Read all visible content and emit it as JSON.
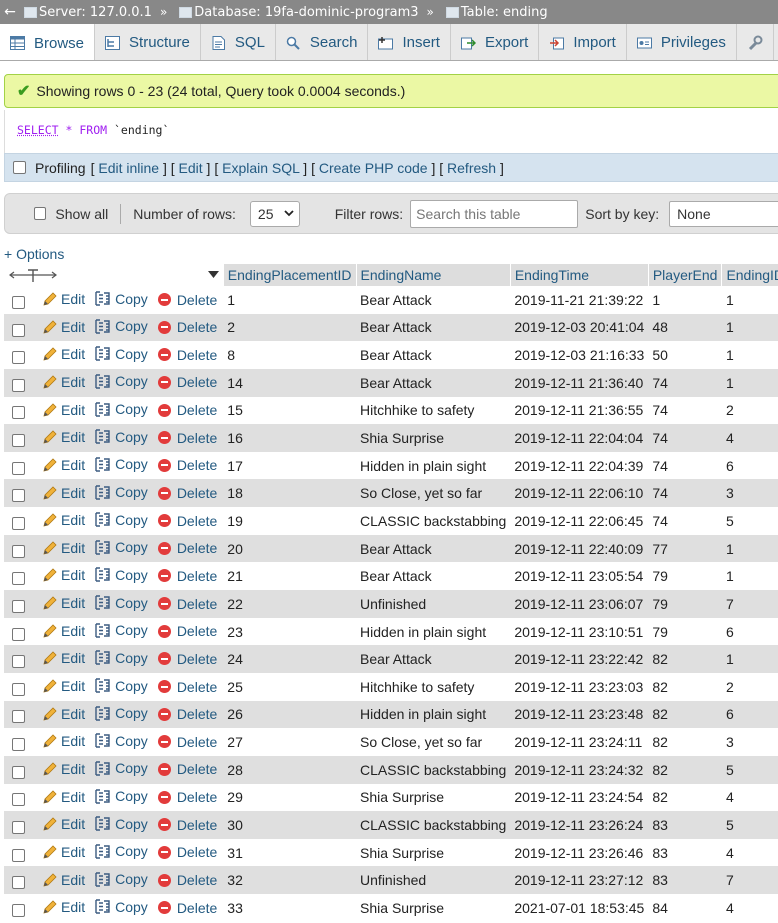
{
  "breadcrumb": {
    "back": "←",
    "server": "Server: 127.0.0.1",
    "database": "Database: 19fa-dominic-program3",
    "table": "Table: ending",
    "separator": "»"
  },
  "tabs": [
    {
      "label": "Browse",
      "icon": "browse-icon",
      "active": true
    },
    {
      "label": "Structure",
      "icon": "structure-icon",
      "active": false
    },
    {
      "label": "SQL",
      "icon": "sql-icon",
      "active": false
    },
    {
      "label": "Search",
      "icon": "search-icon",
      "active": false
    },
    {
      "label": "Insert",
      "icon": "insert-icon",
      "active": false
    },
    {
      "label": "Export",
      "icon": "export-icon",
      "active": false
    },
    {
      "label": "Import",
      "icon": "import-icon",
      "active": false
    },
    {
      "label": "Privileges",
      "icon": "privileges-icon",
      "active": false
    }
  ],
  "message": "Showing rows 0 - 23 (24 total, Query took 0.0004 seconds.)",
  "query": {
    "select": "SELECT",
    "star": "*",
    "from": "FROM",
    "table": "`ending`"
  },
  "profiling": {
    "label": "Profiling",
    "links": [
      "Edit inline",
      "Edit",
      "Explain SQL",
      "Create PHP code",
      "Refresh"
    ]
  },
  "nav": {
    "show_all": "Show all",
    "rows_label": "Number of rows:",
    "rows_value": "25",
    "filter_label": "Filter rows:",
    "filter_placeholder": "Search this table",
    "sort_label": "Sort by key:",
    "sort_value": "None"
  },
  "options_link": "+ Options",
  "table": {
    "columns": [
      "EndingPlacementID",
      "EndingName",
      "EndingTime",
      "PlayerEnd",
      "EndingID"
    ],
    "row_actions": {
      "edit": "Edit",
      "copy": "Copy",
      "delete": "Delete"
    },
    "rows": [
      [
        "1",
        "Bear Attack",
        "2019-11-21 21:39:22",
        "1",
        "1"
      ],
      [
        "2",
        "Bear Attack",
        "2019-12-03 20:41:04",
        "48",
        "1"
      ],
      [
        "8",
        "Bear Attack",
        "2019-12-03 21:16:33",
        "50",
        "1"
      ],
      [
        "14",
        "Bear Attack",
        "2019-12-11 21:36:40",
        "74",
        "1"
      ],
      [
        "15",
        "Hitchhike to safety",
        "2019-12-11 21:36:55",
        "74",
        "2"
      ],
      [
        "16",
        "Shia Surprise",
        "2019-12-11 22:04:04",
        "74",
        "4"
      ],
      [
        "17",
        "Hidden in plain sight",
        "2019-12-11 22:04:39",
        "74",
        "6"
      ],
      [
        "18",
        "So Close, yet so far",
        "2019-12-11 22:06:10",
        "74",
        "3"
      ],
      [
        "19",
        "CLASSIC backstabbing",
        "2019-12-11 22:06:45",
        "74",
        "5"
      ],
      [
        "20",
        "Bear Attack",
        "2019-12-11 22:40:09",
        "77",
        "1"
      ],
      [
        "21",
        "Bear Attack",
        "2019-12-11 23:05:54",
        "79",
        "1"
      ],
      [
        "22",
        "Unfinished",
        "2019-12-11 23:06:07",
        "79",
        "7"
      ],
      [
        "23",
        "Hidden in plain sight",
        "2019-12-11 23:10:51",
        "79",
        "6"
      ],
      [
        "24",
        "Bear Attack",
        "2019-12-11 23:22:42",
        "82",
        "1"
      ],
      [
        "25",
        "Hitchhike to safety",
        "2019-12-11 23:23:03",
        "82",
        "2"
      ],
      [
        "26",
        "Hidden in plain sight",
        "2019-12-11 23:23:48",
        "82",
        "6"
      ],
      [
        "27",
        "So Close, yet so far",
        "2019-12-11 23:24:11",
        "82",
        "3"
      ],
      [
        "28",
        "CLASSIC backstabbing",
        "2019-12-11 23:24:32",
        "82",
        "5"
      ],
      [
        "29",
        "Shia Surprise",
        "2019-12-11 23:24:54",
        "82",
        "4"
      ],
      [
        "30",
        "CLASSIC backstabbing",
        "2019-12-11 23:26:24",
        "83",
        "5"
      ],
      [
        "31",
        "Shia Surprise",
        "2019-12-11 23:26:46",
        "83",
        "4"
      ],
      [
        "32",
        "Unfinished",
        "2019-12-11 23:27:12",
        "83",
        "7"
      ],
      [
        "33",
        "Shia Surprise",
        "2021-07-01 18:53:45",
        "84",
        "4"
      ]
    ]
  }
}
